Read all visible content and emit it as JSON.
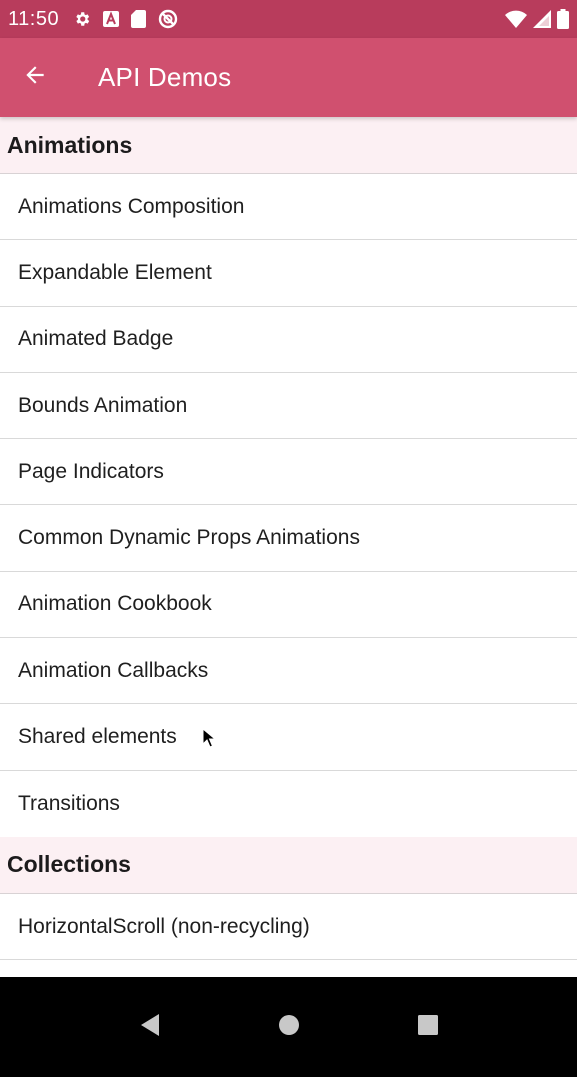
{
  "status_bar": {
    "time": "11:50",
    "icons_left": [
      "gear-icon",
      "a-letter-icon",
      "sd-card-icon",
      "no-sync-icon"
    ],
    "icons_right": [
      "wifi-icon",
      "signal-icon",
      "battery-icon"
    ]
  },
  "app_bar": {
    "title": "API Demos",
    "back_icon": "arrow-back-icon",
    "color": "#d0506f"
  },
  "sections": [
    {
      "header": "Animations",
      "items": [
        "Animations Composition",
        "Expandable Element",
        "Animated Badge",
        "Bounds Animation",
        "Page Indicators",
        "Common Dynamic Props Animations",
        "Animation Cookbook",
        "Animation Callbacks",
        "Shared elements",
        "Transitions"
      ]
    },
    {
      "header": "Collections",
      "items": [
        "HorizontalScroll (non-recycling)"
      ]
    }
  ],
  "nav_bar": {
    "buttons": [
      "back-triangle-icon",
      "home-circle-icon",
      "recents-square-icon"
    ]
  }
}
